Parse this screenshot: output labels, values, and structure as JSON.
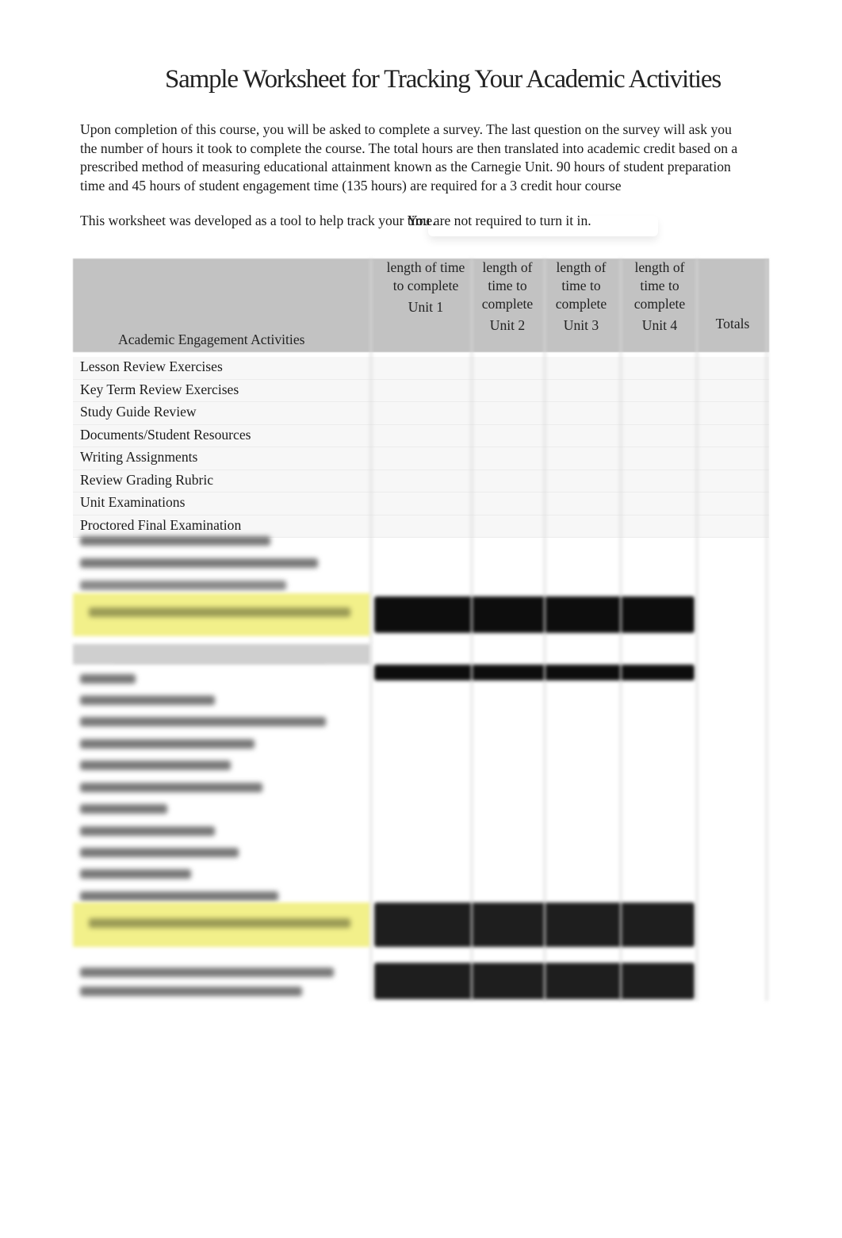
{
  "document": {
    "title": "Sample Worksheet for Tracking Your Academic Activities",
    "intro_lines": [
      "Upon completion of this course, you will be asked to complete a survey. The last question on the survey will ask you",
      "the number of hours it took to complete the course. The total hours are then translated into academic credit based on a",
      "prescribed method of measuring educational attainment known as the Carnegie Unit. 90 hours of student preparation",
      "time and 45 hours of student engagement time (135 hours) are required for a 3 credit hour course"
    ],
    "note_prefix": "This worksheet was developed as a tool to help track your ",
    "note_under": "time.",
    "note_over": "You are not required to turn it in."
  },
  "table": {
    "header": {
      "row_label": "Academic Engagement Activities",
      "columns": [
        {
          "caption": "length of time to complete",
          "unit": "Unit 1"
        },
        {
          "caption": "length of time to complete",
          "unit": "Unit 2"
        },
        {
          "caption": "length of time to complete",
          "unit": "Unit 3"
        },
        {
          "caption": "length of time to complete",
          "unit": "Unit 4"
        },
        {
          "caption": "",
          "unit": "Totals"
        }
      ]
    },
    "engagement_rows": [
      "Lesson Review Exercises",
      "Key Term Review Exercises",
      "Study Guide Review",
      "Documents/Student Resources",
      "Writing Assignments",
      "Review Grading Rubric",
      "Unit Examinations",
      "Proctored Final Examination"
    ],
    "blurred_rows_note": "remaining rows are blurred and illegible",
    "colors": {
      "header_bg": "#c2c2c2",
      "highlight_yellow": "#f2f08a",
      "redacted_black": "#0d0d0d"
    }
  }
}
